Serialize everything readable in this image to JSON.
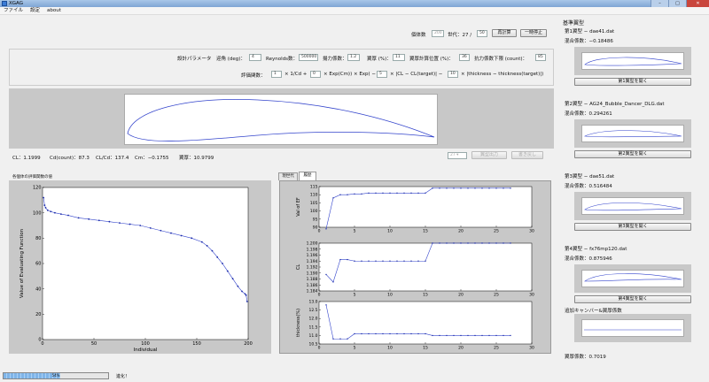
{
  "window": {
    "title": "XGAG"
  },
  "menu": [
    "ファイル",
    "設定",
    "about"
  ],
  "header": {
    "pop_label": "個体数",
    "pop_value": "200",
    "gen_label": "世代：27 /",
    "gen_total": "50",
    "restart_label": "再計算",
    "pause_label": "一時停止"
  },
  "params": {
    "section_label": "設計パラメータ",
    "aoa_label": "迎角 (deg)：",
    "aoa_value": "4",
    "re_label": "Reynolds数：",
    "re_value": "500000",
    "cl_label": "揚力係数：",
    "cl_value": "1.2",
    "thick_label": "翼厚 (%)：",
    "thick_value": "11",
    "thickpos_label": "翼厚計算位置 (%)：",
    "thickpos_value": "36",
    "cdcount_label": "抗力係数下限 (count)：",
    "cdcount_value": "85",
    "eval_label": "評価関数：",
    "eval": {
      "c1": "1",
      "t1": "× 1/Cd +",
      "c2": "0",
      "t2": "× Exp(Cm)) × Exp( −",
      "c3": "5",
      "t3": "× |CL − CL(target)|  −",
      "c4": "10",
      "t4": "× |thickness − thickness(target)|)"
    }
  },
  "results": {
    "cl": "CL：1.1999",
    "cd": "Cd(count)：87.3",
    "clcd": "CL/Cd：137.4",
    "cm": "Cm：−0.1755",
    "thickness": "翼厚：10.9799",
    "select_value": "27",
    "export_label": "翼型出力",
    "overwrite_label": "書き戻し"
  },
  "left_plot": {
    "label": "各個体の評価関数の値"
  },
  "tabs": [
    "現世代",
    "履歴"
  ],
  "chart_data": [
    {
      "type": "line",
      "xlabel": "Individual",
      "ylabel": "Value of Evaluating Function",
      "xlim": [
        0,
        200
      ],
      "ylim": [
        0,
        120
      ],
      "xticks": [
        "0",
        "50",
        "100",
        "150",
        "200"
      ],
      "yticks": [
        "0",
        "20",
        "40",
        "60",
        "80",
        "100",
        "120"
      ],
      "x": [
        1,
        2,
        3,
        5,
        8,
        12,
        18,
        25,
        35,
        45,
        55,
        65,
        75,
        85,
        95,
        105,
        115,
        125,
        135,
        145,
        155,
        160,
        165,
        170,
        175,
        180,
        185,
        190,
        194,
        197,
        198,
        199
      ],
      "y": [
        112,
        106,
        104,
        102,
        101,
        100,
        99,
        98,
        96,
        95,
        94,
        93,
        92,
        91,
        90,
        88,
        86,
        84,
        82,
        80,
        77,
        74,
        70,
        65,
        60,
        54,
        48,
        42,
        38,
        36,
        35,
        30
      ],
      "grid": false
    },
    {
      "type": "line",
      "ylabel": "Val of EF",
      "xlim": [
        0,
        30
      ],
      "ylim": [
        90,
        115
      ],
      "yticks": [
        "90",
        "95",
        "100",
        "105",
        "110",
        "115"
      ],
      "xticks": [
        "0",
        "5",
        "10",
        "15",
        "20",
        "25",
        "30"
      ],
      "x": [
        1,
        2,
        3,
        4,
        5,
        6,
        7,
        8,
        9,
        10,
        11,
        12,
        13,
        14,
        15,
        16,
        17,
        18,
        19,
        20,
        21,
        22,
        23,
        24,
        25,
        26,
        27
      ],
      "y": [
        89,
        108,
        110,
        110,
        110.5,
        110.5,
        111,
        111,
        111,
        111,
        111,
        111,
        111,
        111,
        111,
        114,
        114,
        114,
        114,
        114,
        114,
        114,
        114,
        114,
        114,
        114,
        114
      ]
    },
    {
      "type": "line",
      "ylabel": "CL",
      "xlim": [
        0,
        30
      ],
      "ylim": [
        1.184,
        1.2
      ],
      "yticks": [
        "1.184",
        "1.186",
        "1.188",
        "1.190",
        "1.192",
        "1.194",
        "1.196",
        "1.198",
        "1.200"
      ],
      "xticks": [
        "0",
        "5",
        "10",
        "15",
        "20",
        "25",
        "30"
      ],
      "x": [
        1,
        2,
        3,
        4,
        5,
        6,
        7,
        8,
        9,
        10,
        11,
        12,
        13,
        14,
        15,
        16,
        17,
        18,
        19,
        20,
        21,
        22,
        23,
        24,
        25,
        26,
        27
      ],
      "y": [
        1.1895,
        1.187,
        1.1945,
        1.1945,
        1.194,
        1.194,
        1.194,
        1.194,
        1.194,
        1.194,
        1.194,
        1.194,
        1.194,
        1.194,
        1.194,
        1.2,
        1.2,
        1.2,
        1.2,
        1.2,
        1.2,
        1.2,
        1.2,
        1.2,
        1.2,
        1.2,
        1.2
      ]
    },
    {
      "type": "line",
      "ylabel": "thickness(%)",
      "xlim": [
        0,
        30
      ],
      "ylim": [
        10.5,
        13.0
      ],
      "yticks": [
        "10.5",
        "11.0",
        "11.5",
        "12.0",
        "12.5",
        "13.0"
      ],
      "xticks": [
        "0",
        "5",
        "10",
        "15",
        "20",
        "25",
        "30"
      ],
      "x": [
        1,
        2,
        3,
        4,
        5,
        6,
        7,
        8,
        9,
        10,
        11,
        12,
        13,
        14,
        15,
        16,
        17,
        18,
        19,
        20,
        21,
        22,
        23,
        24,
        25,
        26,
        27
      ],
      "y": [
        12.8,
        10.8,
        10.8,
        10.8,
        11.1,
        11.1,
        11.1,
        11.1,
        11.1,
        11.1,
        11.1,
        11.1,
        11.1,
        11.1,
        11.1,
        11.0,
        11.0,
        11.0,
        11.0,
        11.0,
        11.0,
        11.0,
        11.0,
        11.0,
        11.0,
        11.0,
        11.0
      ]
    }
  ],
  "sidebar": {
    "title": "基準翼型",
    "items": [
      {
        "name": "第1翼型 − dae41.dat",
        "mix": "混合係数：−0.18486",
        "button": "第1翼型を開く"
      },
      {
        "name": "第2翼型 − AG24_Bubble_Dancer_DLG.dat",
        "mix": "混合係数：0.294261",
        "button": "第2翼型を開く"
      },
      {
        "name": "第3翼型 − dae51.dat",
        "mix": "混合係数：0.516484",
        "button": "第3翼型を開く"
      },
      {
        "name": "第4翼型 − fx76mp120.dat",
        "mix": "混合係数：0.875946",
        "button": "第4翼型を開く"
      }
    ],
    "camber_label": "追加キャンバー&翼厚係数",
    "thick_coef": "翼厚係数：0.7019"
  },
  "status": {
    "progress": 0.54,
    "progress_text": "54%",
    "text": "進化！"
  }
}
